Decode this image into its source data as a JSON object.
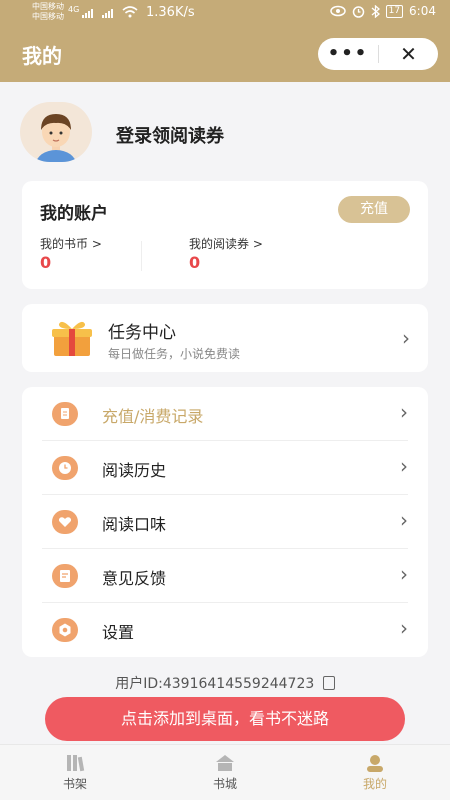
{
  "status_bar": {
    "carrier_1": "中国移动",
    "carrier_2": "中国移动",
    "network": "4G",
    "speed": "1.36K/s",
    "battery": "17",
    "time": "6:04"
  },
  "navbar": {
    "title": "我的",
    "more_glyph": "•••",
    "close_glyph": "✕"
  },
  "profile": {
    "login_text": "登录领阅读券"
  },
  "account": {
    "title": "我的账户",
    "recharge_label": "充值",
    "coins_label": "我的书币 >",
    "coins_value": "0",
    "vouchers_label": "我的阅读券 >",
    "vouchers_value": "0"
  },
  "task": {
    "title": "任务中心",
    "subtitle": "每日做任务，小说免费读"
  },
  "menu": {
    "items": [
      {
        "label": "充值/消费记录",
        "icon": "receipt-icon"
      },
      {
        "label": "阅读历史",
        "icon": "clock-icon"
      },
      {
        "label": "阅读口味",
        "icon": "heart-icon"
      },
      {
        "label": "意见反馈",
        "icon": "edit-icon"
      },
      {
        "label": "设置",
        "icon": "gear-icon"
      }
    ]
  },
  "user_id": "用户ID:43916414559244723",
  "banner": "点击添加到桌面，看书不迷路",
  "tabs": [
    {
      "label": "书架",
      "icon": "bookshelf-icon"
    },
    {
      "label": "书城",
      "icon": "bookstore-icon"
    },
    {
      "label": "我的",
      "icon": "user-icon"
    }
  ],
  "colors": {
    "brand": "#c5ab78",
    "accent_red": "#e8484b",
    "icon_orange": "#f0a36d"
  }
}
